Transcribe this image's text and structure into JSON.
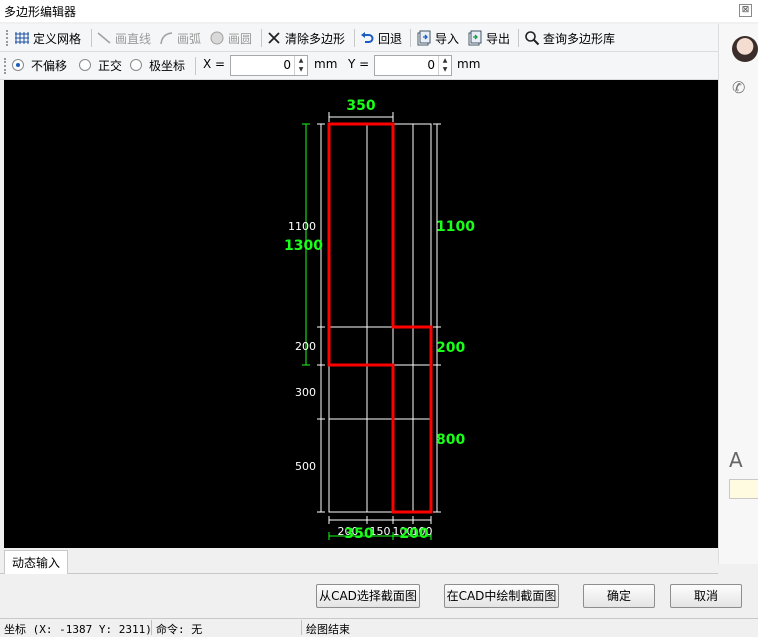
{
  "window": {
    "title": "多边形编辑器",
    "close_glyph": "⊠"
  },
  "toolbar1": {
    "define_grid": "定义网格",
    "draw_line": "画直线",
    "draw_arc": "画弧",
    "draw_circle": "画圆",
    "clear_polygon": "清除多边形",
    "undo": "回退",
    "import": "导入",
    "export": "导出",
    "query_library": "查询多边形库"
  },
  "toolbar2": {
    "mode_no_offset": "不偏移",
    "mode_orthogonal": "正交",
    "mode_polar": "极坐标",
    "x_label": "X =",
    "x_value": "0",
    "x_unit": "mm",
    "y_label": "Y =",
    "y_value": "0",
    "y_unit": "mm"
  },
  "drawing": {
    "top_dim": "350",
    "left_dims": [
      "1100",
      "200",
      "300",
      "500"
    ],
    "left_total": "1300",
    "right_dims": [
      "1100",
      "200",
      "800"
    ],
    "bottom_white_dims": [
      "200",
      "150",
      "100",
      "100"
    ],
    "bottom_green_dims": [
      "350",
      "200"
    ]
  },
  "tabs": {
    "dynamic_input": "动态输入"
  },
  "buttons": {
    "select_from_cad": "从CAD选择截面图",
    "draw_in_cad": "在CAD中绘制截面图",
    "ok": "确定",
    "cancel": "取消"
  },
  "status": {
    "coords": "坐标 (X: -1387 Y: 2311)",
    "command": "命令: 无",
    "message": "绘图结束"
  },
  "colors": {
    "accent_green": "#19ff19",
    "polygon_red": "#ff0000",
    "canvas": "#000000"
  }
}
